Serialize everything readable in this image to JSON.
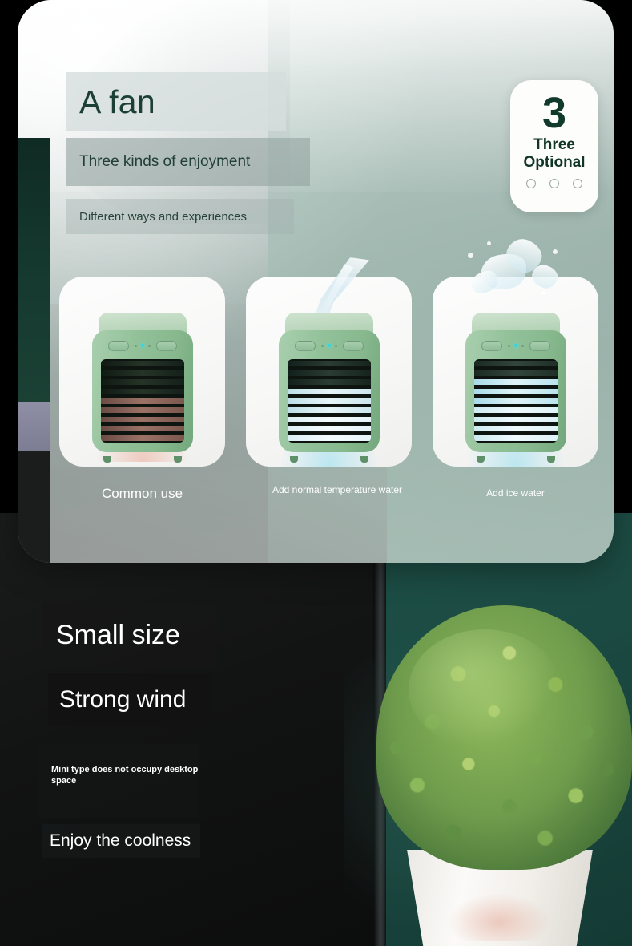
{
  "hero": {
    "title": "A fan",
    "subtitle": "Three kinds of enjoyment",
    "tagline": "Different ways and experiences"
  },
  "badge": {
    "number": "3",
    "line1": "Three",
    "line2": "Optional",
    "dot_count": 3
  },
  "cards": [
    {
      "caption": "Common use",
      "mode": "warm"
    },
    {
      "caption": "Add normal temperature water",
      "mode": "cool"
    },
    {
      "caption": "Add ice water",
      "mode": "ice"
    }
  ],
  "features": {
    "heading1": "Small size",
    "heading2": "Strong wind",
    "body": "Mini type does not occupy desktop space",
    "heading3": "Enjoy the coolness"
  },
  "colors": {
    "deep_green": "#123a2c",
    "panel_sage": "#9fb1ac",
    "scene_green": "#1d4f46",
    "fan_green": "#93c29a",
    "led_cyan": "#2fd8e6",
    "text_white": "#ffffff"
  }
}
